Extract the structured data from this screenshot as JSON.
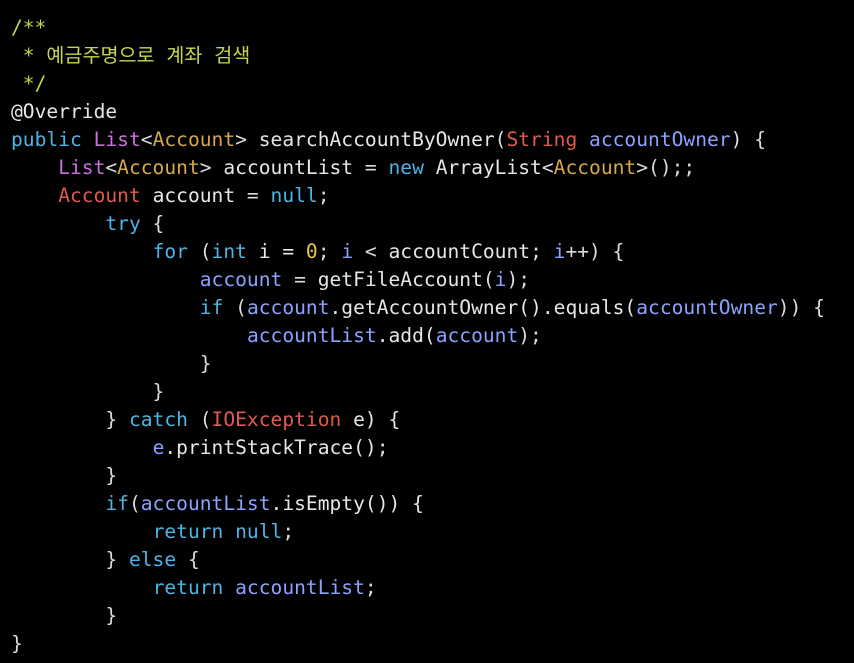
{
  "editor": {
    "background": "#000000",
    "lines": [
      [
        {
          "t": "/**",
          "c": "tok-comment"
        }
      ],
      [
        {
          "t": " * 예금주명으로 계좌 검색",
          "c": "tok-comment"
        }
      ],
      [
        {
          "t": " */",
          "c": "tok-comment"
        }
      ],
      [
        {
          "t": "@Override",
          "c": "tok-annotation"
        }
      ],
      [
        {
          "t": "public ",
          "c": "tok-keyword"
        },
        {
          "t": "List",
          "c": "tok-list"
        },
        {
          "t": "<",
          "c": "tok-punct"
        },
        {
          "t": "Account",
          "c": "tok-generic"
        },
        {
          "t": "> ",
          "c": "tok-punct"
        },
        {
          "t": "searchAccountByOwner",
          "c": "tok-method"
        },
        {
          "t": "(",
          "c": "tok-punct"
        },
        {
          "t": "String ",
          "c": "tok-string-type"
        },
        {
          "t": "accountOwner",
          "c": "tok-var"
        },
        {
          "t": ") {",
          "c": "tok-punct"
        }
      ],
      [
        {
          "t": "    ",
          "c": "tok-plain"
        },
        {
          "t": "List",
          "c": "tok-list"
        },
        {
          "t": "<",
          "c": "tok-punct"
        },
        {
          "t": "Account",
          "c": "tok-generic"
        },
        {
          "t": "> ",
          "c": "tok-punct"
        },
        {
          "t": "accountList",
          "c": "tok-plain"
        },
        {
          "t": " = ",
          "c": "tok-punct"
        },
        {
          "t": "new ",
          "c": "tok-keyword"
        },
        {
          "t": "ArrayList",
          "c": "tok-plain"
        },
        {
          "t": "<",
          "c": "tok-punct"
        },
        {
          "t": "Account",
          "c": "tok-generic"
        },
        {
          "t": ">();;",
          "c": "tok-punct"
        }
      ],
      [
        {
          "t": "    ",
          "c": "tok-plain"
        },
        {
          "t": "Account ",
          "c": "tok-string-type"
        },
        {
          "t": "account",
          "c": "tok-plain"
        },
        {
          "t": " = ",
          "c": "tok-punct"
        },
        {
          "t": "null",
          "c": "tok-keyword"
        },
        {
          "t": ";",
          "c": "tok-punct"
        }
      ],
      [
        {
          "t": "        ",
          "c": "tok-plain"
        },
        {
          "t": "try",
          "c": "tok-keyword"
        },
        {
          "t": " {",
          "c": "tok-punct"
        }
      ],
      [
        {
          "t": "            ",
          "c": "tok-plain"
        },
        {
          "t": "for",
          "c": "tok-keyword"
        },
        {
          "t": " (",
          "c": "tok-punct"
        },
        {
          "t": "int",
          "c": "tok-keyword"
        },
        {
          "t": " i = ",
          "c": "tok-plain"
        },
        {
          "t": "0",
          "c": "tok-number"
        },
        {
          "t": "; ",
          "c": "tok-punct"
        },
        {
          "t": "i",
          "c": "tok-var"
        },
        {
          "t": " < ",
          "c": "tok-punct"
        },
        {
          "t": "accountCount",
          "c": "tok-plain"
        },
        {
          "t": "; ",
          "c": "tok-punct"
        },
        {
          "t": "i",
          "c": "tok-var"
        },
        {
          "t": "++) {",
          "c": "tok-punct"
        }
      ],
      [
        {
          "t": "                ",
          "c": "tok-plain"
        },
        {
          "t": "account",
          "c": "tok-var"
        },
        {
          "t": " = ",
          "c": "tok-punct"
        },
        {
          "t": "getFileAccount",
          "c": "tok-method"
        },
        {
          "t": "(",
          "c": "tok-punct"
        },
        {
          "t": "i",
          "c": "tok-var"
        },
        {
          "t": ");",
          "c": "tok-punct"
        }
      ],
      [
        {
          "t": "                ",
          "c": "tok-plain"
        },
        {
          "t": "if",
          "c": "tok-keyword"
        },
        {
          "t": " (",
          "c": "tok-punct"
        },
        {
          "t": "account",
          "c": "tok-var"
        },
        {
          "t": ".getAccountOwner().equals(",
          "c": "tok-method"
        },
        {
          "t": "accountOwner",
          "c": "tok-var"
        },
        {
          "t": ")) {",
          "c": "tok-punct"
        }
      ],
      [
        {
          "t": "                    ",
          "c": "tok-plain"
        },
        {
          "t": "accountList",
          "c": "tok-var"
        },
        {
          "t": ".add(",
          "c": "tok-method"
        },
        {
          "t": "account",
          "c": "tok-var"
        },
        {
          "t": ");",
          "c": "tok-punct"
        }
      ],
      [
        {
          "t": "                }",
          "c": "tok-punct"
        }
      ],
      [
        {
          "t": "            }",
          "c": "tok-punct"
        }
      ],
      [
        {
          "t": "        } ",
          "c": "tok-punct"
        },
        {
          "t": "catch",
          "c": "tok-keyword"
        },
        {
          "t": " (",
          "c": "tok-punct"
        },
        {
          "t": "IOException ",
          "c": "tok-exc"
        },
        {
          "t": "e) {",
          "c": "tok-plain"
        }
      ],
      [
        {
          "t": "            ",
          "c": "tok-plain"
        },
        {
          "t": "e",
          "c": "tok-var"
        },
        {
          "t": ".printStackTrace();",
          "c": "tok-method"
        }
      ],
      [
        {
          "t": "        }",
          "c": "tok-punct"
        }
      ],
      [
        {
          "t": "        ",
          "c": "tok-plain"
        },
        {
          "t": "if",
          "c": "tok-keyword"
        },
        {
          "t": "(",
          "c": "tok-punct"
        },
        {
          "t": "accountList",
          "c": "tok-var"
        },
        {
          "t": ".isEmpty()) {",
          "c": "tok-method"
        }
      ],
      [
        {
          "t": "            ",
          "c": "tok-plain"
        },
        {
          "t": "return",
          "c": "tok-keyword"
        },
        {
          "t": " ",
          "c": "tok-plain"
        },
        {
          "t": "null",
          "c": "tok-keyword"
        },
        {
          "t": ";",
          "c": "tok-punct"
        }
      ],
      [
        {
          "t": "        } ",
          "c": "tok-punct"
        },
        {
          "t": "else",
          "c": "tok-keyword"
        },
        {
          "t": " {",
          "c": "tok-punct"
        }
      ],
      [
        {
          "t": "            ",
          "c": "tok-plain"
        },
        {
          "t": "return",
          "c": "tok-keyword"
        },
        {
          "t": " ",
          "c": "tok-plain"
        },
        {
          "t": "accountList",
          "c": "tok-var"
        },
        {
          "t": ";",
          "c": "tok-punct"
        }
      ],
      [
        {
          "t": "        }",
          "c": "tok-punct"
        }
      ],
      [
        {
          "t": "}",
          "c": "tok-punct"
        }
      ]
    ]
  }
}
